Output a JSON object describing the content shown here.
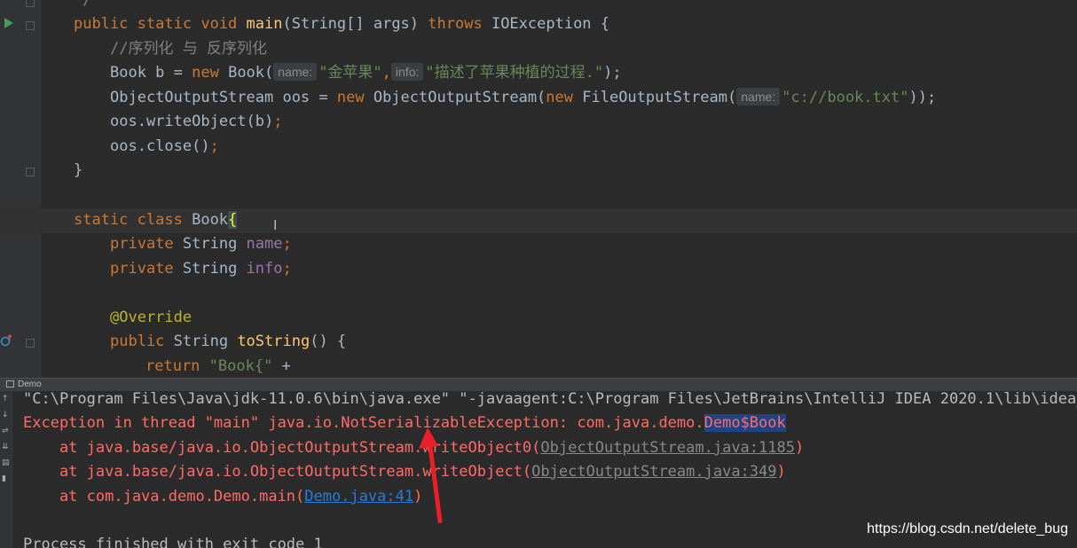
{
  "editor": {
    "line0": {
      "comment_end": "*/"
    },
    "line1": {
      "kw1": "public",
      "kw2": "static",
      "kw3": "void",
      "method": "main",
      "params": "(String[] args)",
      "throws": "throws",
      "exception": "IOException {"
    },
    "line2": {
      "comment": "//序列化 与 反序列化"
    },
    "line3": {
      "pre": "Book b = ",
      "new_kw": "new",
      "ctor": " Book(",
      "hint1": "name:",
      "str1": "\"金苹果\"",
      "comma": ",",
      "hint2": "info:",
      "str2": "\"描述了苹果种植的过程.\"",
      "end": ");"
    },
    "line4": {
      "pre": "ObjectOutputStream oos = ",
      "new1": "new",
      "mid": " ObjectOutputStream(",
      "new2": "new",
      "mid2": " FileOutputStream(",
      "hint": "name:",
      "str": "\"c://book.txt\"",
      "end": "));"
    },
    "line5": {
      "text": "oos.writeObject(b)",
      "semi": ";"
    },
    "line6": {
      "text": "oos.close()",
      "semi": ";"
    },
    "line7": {
      "text": "}"
    },
    "line9": {
      "kw1": "static",
      "kw2": "class",
      "name": " Book",
      "brace": "{"
    },
    "line10": {
      "kw": "private",
      "type": " String ",
      "field": "name",
      "semi": ";"
    },
    "line11": {
      "kw": "private",
      "type": " String ",
      "field": "info",
      "semi": ";"
    },
    "line13": {
      "annotation": "@Override"
    },
    "line14": {
      "kw": "public",
      "type": " String ",
      "method": "toString",
      "rest": "() {"
    },
    "line15": {
      "kw": "return",
      "str": " \"Book{\"",
      "rest": " +"
    }
  },
  "run_tab": {
    "label": "Demo"
  },
  "console": {
    "cmd": "\"C:\\Program Files\\Java\\jdk-11.0.6\\bin\\java.exe\" \"-javaagent:C:\\Program Files\\JetBrains\\IntelliJ IDEA 2020.1\\lib\\idea_",
    "exception_pre": "Exception in thread \"main\" java.io.NotSerializableException: com.java.demo.",
    "exception_class": "Demo$Book",
    "trace1_pre": "    at java.base/java.io.ObjectOutputStream.writeObject0(",
    "trace1_link": "ObjectOutputStream.java:1185",
    "trace1_end": ")",
    "trace2_pre": "    at java.base/java.io.ObjectOutputStream.writeObject(",
    "trace2_link": "ObjectOutputStream.java:349",
    "trace2_end": ")",
    "trace3_pre": "    at com.java.demo.Demo.main(",
    "trace3_link": "Demo.java:41",
    "trace3_end": ")",
    "finished": "Process finished with exit code 1"
  },
  "watermark": "https://blog.csdn.net/delete_bug",
  "colors": {
    "keyword": "#cc7832",
    "string": "#6a8759",
    "error": "#ff6b68",
    "link": "#287bde",
    "background": "#2b2b2b"
  }
}
